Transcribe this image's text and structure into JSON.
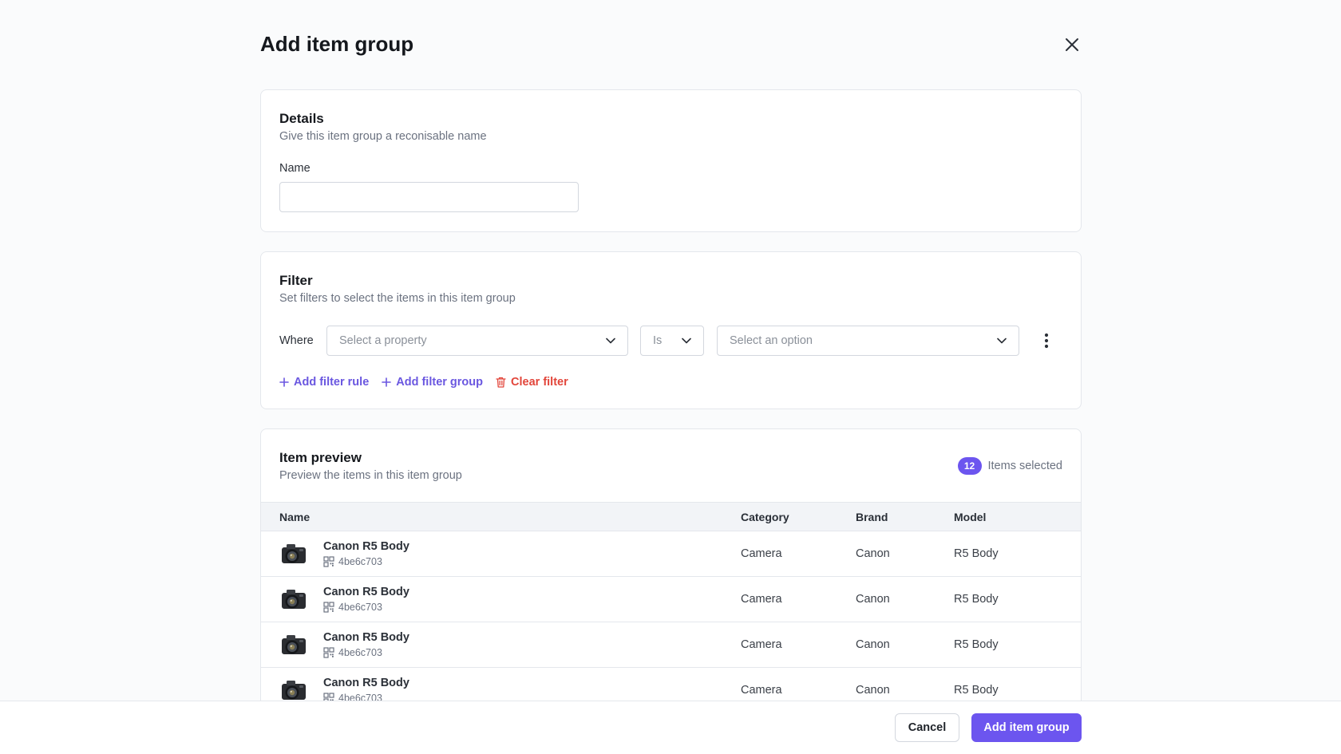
{
  "modal": {
    "title": "Add item group"
  },
  "details": {
    "title": "Details",
    "subtitle": "Give this item group a reconisable name",
    "name_label": "Name",
    "name_value": "",
    "name_placeholder": ""
  },
  "filter": {
    "title": "Filter",
    "subtitle": "Set filters to select the items in this item group",
    "where_label": "Where",
    "property_placeholder": "Select a property",
    "operator_value": "Is",
    "option_placeholder": "Select an option",
    "add_rule_label": "Add filter rule",
    "add_group_label": "Add filter group",
    "clear_label": "Clear filter"
  },
  "preview": {
    "title": "Item preview",
    "subtitle": "Preview the items in this item group",
    "selected_count": "12",
    "selected_label": "Items selected",
    "columns": {
      "name": "Name",
      "category": "Category",
      "brand": "Brand",
      "model": "Model"
    },
    "rows": [
      {
        "name": "Canon R5 Body",
        "code": "4be6c703",
        "category": "Camera",
        "brand": "Canon",
        "model": "R5 Body"
      },
      {
        "name": "Canon R5 Body",
        "code": "4be6c703",
        "category": "Camera",
        "brand": "Canon",
        "model": "R5 Body"
      },
      {
        "name": "Canon R5 Body",
        "code": "4be6c703",
        "category": "Camera",
        "brand": "Canon",
        "model": "R5 Body"
      },
      {
        "name": "Canon R5 Body",
        "code": "4be6c703",
        "category": "Camera",
        "brand": "Canon",
        "model": "R5 Body"
      }
    ]
  },
  "footer": {
    "cancel_label": "Cancel",
    "submit_label": "Add item group"
  },
  "colors": {
    "accent": "#6c55ef",
    "danger": "#e2453a",
    "link": "#6a57e0"
  },
  "icons": {
    "close": "close-icon",
    "chevron": "chevron-down-icon",
    "kebab": "more-vertical-icon",
    "plus": "plus-icon",
    "trash": "trash-icon",
    "qr": "qr-code-icon",
    "thumb": "camera-icon"
  }
}
